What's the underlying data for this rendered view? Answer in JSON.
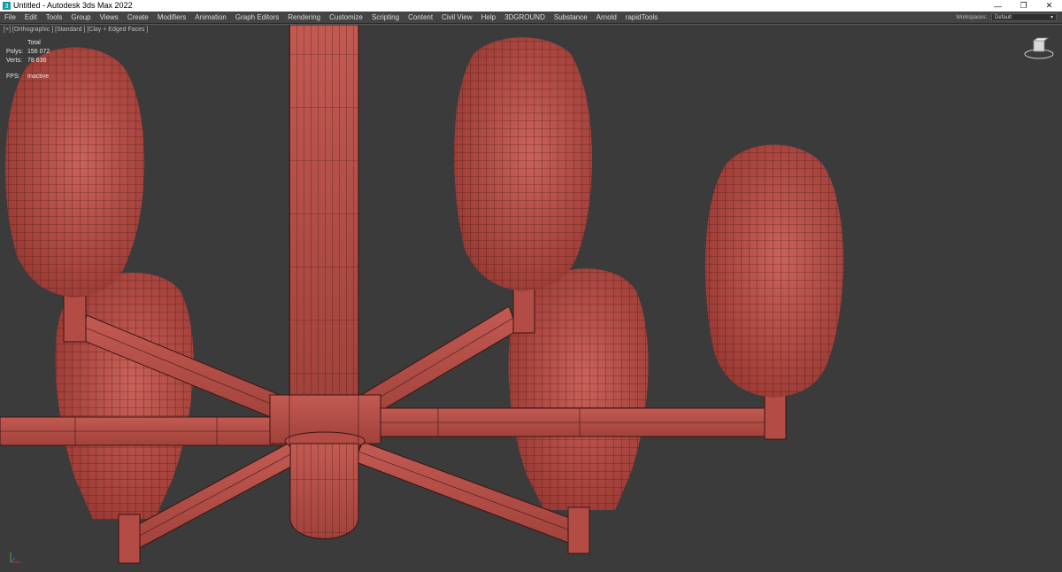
{
  "window": {
    "title": "Untitled - Autodesk 3ds Max 2022"
  },
  "menu": [
    "File",
    "Edit",
    "Tools",
    "Group",
    "Views",
    "Create",
    "Modifiers",
    "Animation",
    "Graph Editors",
    "Rendering",
    "Customize",
    "Scripting",
    "Content",
    "Civil View",
    "Help",
    "3DGROUND",
    "Substance",
    "Arnold",
    "rapidTools"
  ],
  "workspaces": {
    "label": "Workspaces:",
    "value": "Default"
  },
  "viewport": {
    "label": "[+] [Orthographic ] [Standard ] [Clay + Edged Faces ]",
    "stats": {
      "header": "Total",
      "polys_label": "Polys:",
      "polys_value": "156 072",
      "verts_label": "Verts:",
      "verts_value": "78 636",
      "fps_label": "FPS:",
      "fps_value": "Inactive"
    }
  },
  "colors": {
    "clay": "#b84a43",
    "viewport_bg": "#3b3b3b",
    "wire": "#3a1412"
  }
}
